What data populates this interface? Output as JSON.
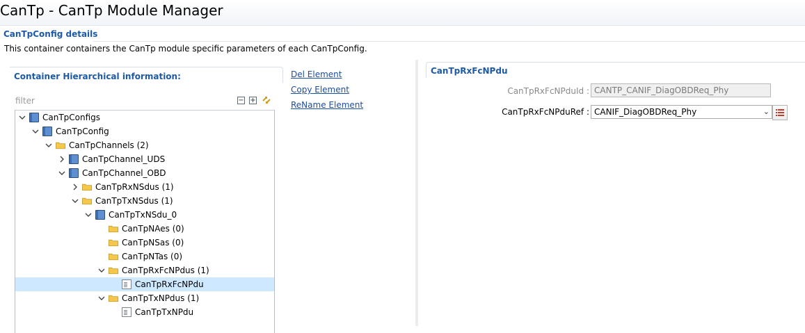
{
  "window": {
    "title": "CanTp - CanTp Module Manager"
  },
  "details": {
    "title": "CanTpConfig details",
    "description": "This container containers the CanTp module specific parameters of each CanTpConfig."
  },
  "hierarchy": {
    "title": "Container Hierarchical information:",
    "filter_placeholder": "filter",
    "tree": [
      {
        "label": "CanTpConfigs",
        "icon": "module-icon",
        "expander": "expanded"
      },
      {
        "label": "CanTpConfig",
        "icon": "module-icon",
        "expander": "expanded"
      },
      {
        "label": "CanTpChannels (2)",
        "icon": "folder-icon",
        "expander": "expanded"
      },
      {
        "label": "CanTpChannel_UDS",
        "icon": "module-icon",
        "expander": "collapsed"
      },
      {
        "label": "CanTpChannel_OBD",
        "icon": "module-icon",
        "expander": "expanded"
      },
      {
        "label": "CanTpRxNSdus (1)",
        "icon": "folder-icon",
        "expander": "collapsed"
      },
      {
        "label": "CanTpTxNSdus (1)",
        "icon": "folder-icon",
        "expander": "expanded"
      },
      {
        "label": "CanTpTxNSdu_0",
        "icon": "module-icon",
        "expander": "expanded"
      },
      {
        "label": "CanTpNAes (0)",
        "icon": "folder-icon",
        "expander": "none"
      },
      {
        "label": "CanTpNSas (0)",
        "icon": "folder-icon",
        "expander": "none"
      },
      {
        "label": "CanTpNTas (0)",
        "icon": "folder-icon",
        "expander": "none"
      },
      {
        "label": "CanTpRxFcNPdus (1)",
        "icon": "folder-icon",
        "expander": "expanded"
      },
      {
        "label": "CanTpRxFcNPdu",
        "icon": "document-icon",
        "expander": "none",
        "selected": true
      },
      {
        "label": "CanTpTxNPdus (1)",
        "icon": "folder-icon",
        "expander": "expanded"
      },
      {
        "label": "CanTpTxNPdu",
        "icon": "document-icon",
        "expander": "none"
      }
    ]
  },
  "actions": {
    "del": "Del Element",
    "copy": "Copy Element",
    "rename": "ReName Element"
  },
  "properties": {
    "title": "CanTpRxFcNPdu",
    "pduid_label": "CanTpRxFcNPduId :",
    "pduid_value": "CANTP_CANIF_DiagOBDReq_Phy",
    "pduref_label": "CanTpRxFcNPduRef :",
    "pduref_value": "CANIF_DiagOBDReq_Phy"
  },
  "colors": {
    "accent": "#1c5aa8",
    "link": "#1c4ea0",
    "selection": "#cde8ff",
    "folder": "#f5c84c"
  }
}
